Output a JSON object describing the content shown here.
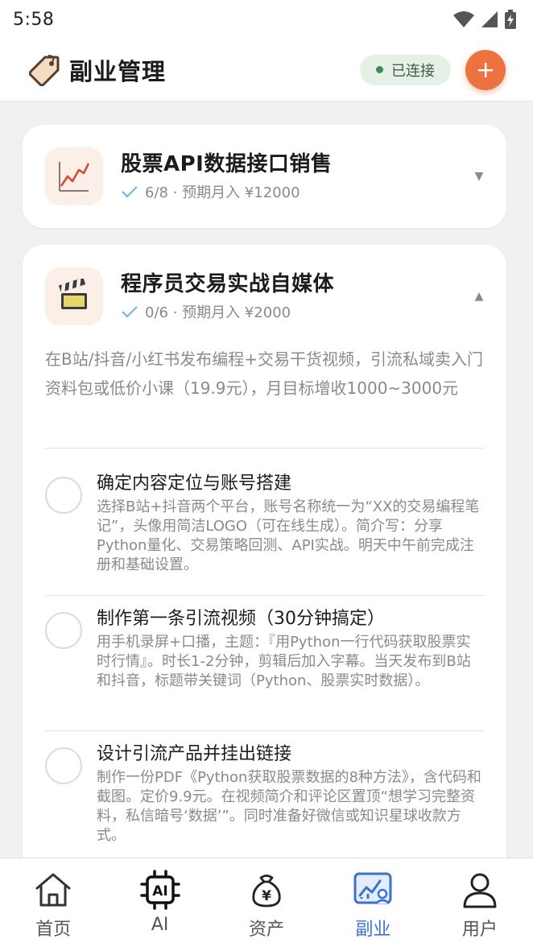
{
  "status_bar": {
    "time": "5:58"
  },
  "header": {
    "title": "副业管理",
    "connection_status": "已连接",
    "add_label": "+"
  },
  "projects": [
    {
      "title": "股票API数据接口销售",
      "meta": "6/8 · 预期月入 ¥12000",
      "expanded": false,
      "chevron": "▼",
      "icon": "chart-increasing-icon"
    },
    {
      "title": "程序员交易实战自媒体",
      "meta": "0/6 · 预期月入 ¥2000",
      "expanded": true,
      "chevron": "▲",
      "icon": "clapper-board-icon",
      "description": "在B站/抖音/小红书发布编程+交易干货视频，引流私域卖入门资料包或低价小课（19.9元），月目标增收1000~3000元",
      "tasks": [
        {
          "title": "确定内容定位与账号搭建",
          "detail": "选择B站+抖音两个平台，账号名称统一为“XX的交易编程笔记”，头像用简洁LOGO（可在线生成）。简介写：分享Python量化、交易策略回测、API实战。明天中午前完成注册和基础设置。"
        },
        {
          "title": "制作第一条引流视频（30分钟搞定）",
          "detail": "用手机录屏+口播，主题：『用Python一行代码获取股票实时行情』。时长1-2分钟，剪辑后加入字幕。当天发布到B站和抖音，标题带关键词（Python、股票实时数据）。"
        },
        {
          "title": "设计引流产品并挂出链接",
          "detail": "制作一份PDF《Python获取股票数据的8种方法》，含代码和截图。定价9.9元。在视频简介和评论区置顶“想学习完整资料，私信暗号‘数据’”。同时准备好微信或知识星球收款方式。"
        }
      ]
    }
  ],
  "bottom_nav": {
    "active": "副业",
    "items": [
      {
        "label": "首页",
        "icon": "home-icon"
      },
      {
        "label": "AI",
        "icon": "ai-chip-icon"
      },
      {
        "label": "资产",
        "icon": "money-bag-icon"
      },
      {
        "label": "副业",
        "icon": "chart-profile-icon"
      },
      {
        "label": "用户",
        "icon": "user-icon"
      }
    ]
  },
  "colors": {
    "accent_orange": "#ec7340",
    "active_blue": "#3b6fd0",
    "connected_green": "#3f8a55"
  }
}
